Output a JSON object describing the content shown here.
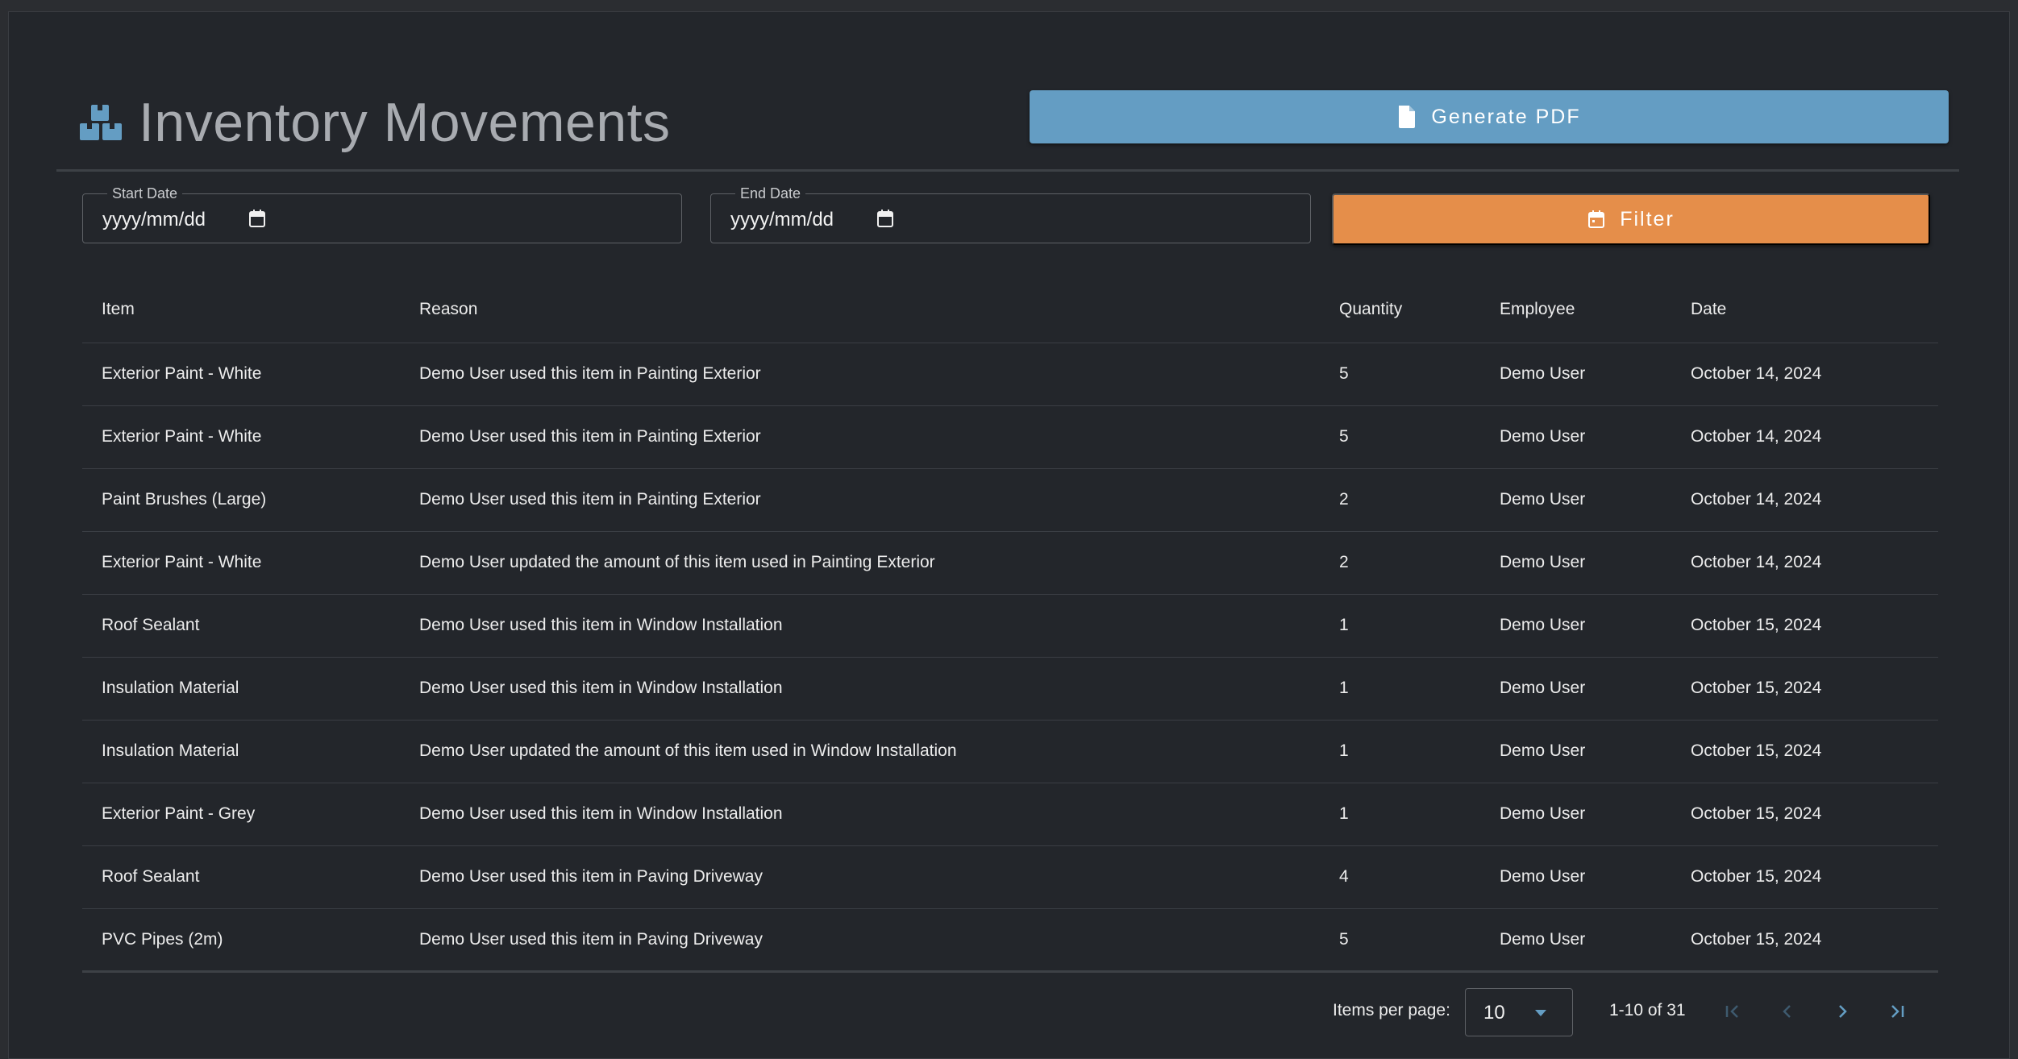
{
  "header": {
    "title": "Inventory Movements",
    "title_icon": "boxes-icon",
    "generate_pdf_label": "Generate PDF",
    "generate_pdf_icon": "file-icon"
  },
  "filters": {
    "start_date": {
      "legend": "Start Date",
      "value": "yyyy/mm/dd"
    },
    "end_date": {
      "legend": "End Date",
      "value": "yyyy/mm/dd"
    },
    "filter_label": "Filter",
    "filter_icon": "calendar-icon"
  },
  "table": {
    "columns": [
      "Item",
      "Reason",
      "Quantity",
      "Employee",
      "Date"
    ],
    "rows": [
      [
        "Exterior Paint - White",
        "Demo User used this item in Painting Exterior",
        "5",
        "Demo User",
        "October 14, 2024"
      ],
      [
        "Exterior Paint - White",
        "Demo User used this item in Painting Exterior",
        "5",
        "Demo User",
        "October 14, 2024"
      ],
      [
        "Paint Brushes (Large)",
        "Demo User used this item in Painting Exterior",
        "2",
        "Demo User",
        "October 14, 2024"
      ],
      [
        "Exterior Paint - White",
        "Demo User updated the amount of this item used in Painting Exterior",
        "2",
        "Demo User",
        "October 14, 2024"
      ],
      [
        "Roof Sealant",
        "Demo User used this item in Window Installation",
        "1",
        "Demo User",
        "October 15, 2024"
      ],
      [
        "Insulation Material",
        "Demo User used this item in Window Installation",
        "1",
        "Demo User",
        "October 15, 2024"
      ],
      [
        "Insulation Material",
        "Demo User updated the amount of this item used in Window Installation",
        "1",
        "Demo User",
        "October 15, 2024"
      ],
      [
        "Exterior Paint - Grey",
        "Demo User used this item in Window Installation",
        "1",
        "Demo User",
        "October 15, 2024"
      ],
      [
        "Roof Sealant",
        "Demo User used this item in Paving Driveway",
        "4",
        "Demo User",
        "October 15, 2024"
      ],
      [
        "PVC Pipes (2m)",
        "Demo User used this item in Paving Driveway",
        "5",
        "Demo User",
        "October 15, 2024"
      ]
    ]
  },
  "paginator": {
    "items_per_page_label": "Items per page:",
    "items_per_page_value": "10",
    "range_label": "1-10 of 31"
  },
  "colors": {
    "background": "#23262b",
    "primary": "#649dc3",
    "accent": "#e58e4a",
    "title_text": "#a8abb0"
  }
}
